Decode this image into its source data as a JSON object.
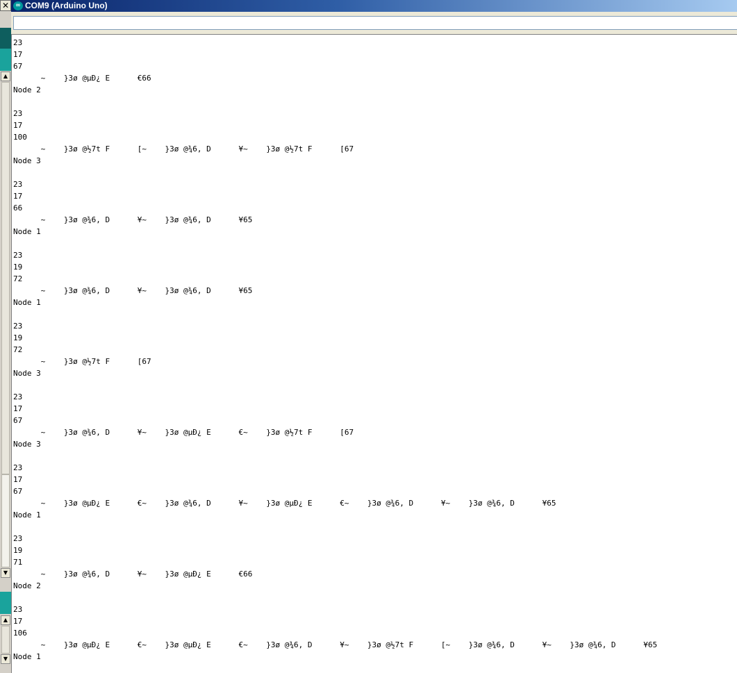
{
  "window": {
    "title": "COM9 (Arduino Uno)",
    "close_glyph": "✕",
    "app_icon": "arduino-logo-icon",
    "app_icon_glyph": "∞"
  },
  "input": {
    "value": "",
    "placeholder": ""
  },
  "scrollbar": {
    "up_glyph": "▲",
    "down_glyph": "▼"
  },
  "colors": {
    "title_start": "#0a246a",
    "title_end": "#a6caf0",
    "teal": "#00979c",
    "frame": "#d4d0c8"
  },
  "output_lines": [
    "23",
    "17",
    "67",
    "      ~    }3ø @µÐ¿ E      €66",
    "Node 2",
    "",
    "23",
    "17",
    "100",
    "      ~    }3ø @½7t F      [~    }3ø @¾6, D      ¥~    }3ø @½7t F      [67",
    "Node 3",
    "",
    "23",
    "17",
    "66",
    "      ~    }3ø @¾6, D      ¥~    }3ø @¾6, D      ¥65",
    "Node 1",
    "",
    "23",
    "19",
    "72",
    "      ~    }3ø @¾6, D      ¥~    }3ø @¾6, D      ¥65",
    "Node 1",
    "",
    "23",
    "19",
    "72",
    "      ~    }3ø @½7t F      [67",
    "Node 3",
    "",
    "23",
    "17",
    "67",
    "      ~    }3ø @¾6, D      ¥~    }3ø @µÐ¿ E      €~    }3ø @½7t F      [67",
    "Node 3",
    "",
    "23",
    "17",
    "67",
    "      ~    }3ø @µÐ¿ E      €~    }3ø @¾6, D      ¥~    }3ø @µÐ¿ E      €~    }3ø @¾6, D      ¥~    }3ø @¾6, D      ¥65",
    "Node 1",
    "",
    "23",
    "19",
    "71",
    "      ~    }3ø @¾6, D      ¥~    }3ø @µÐ¿ E      €66",
    "Node 2",
    "",
    "23",
    "17",
    "106",
    "      ~    }3ø @µÐ¿ E      €~    }3ø @µÐ¿ E      €~    }3ø @¾6, D      ¥~    }3ø @½7t F      [~    }3ø @¾6, D      ¥~    }3ø @¾6, D      ¥65",
    "Node 1"
  ]
}
